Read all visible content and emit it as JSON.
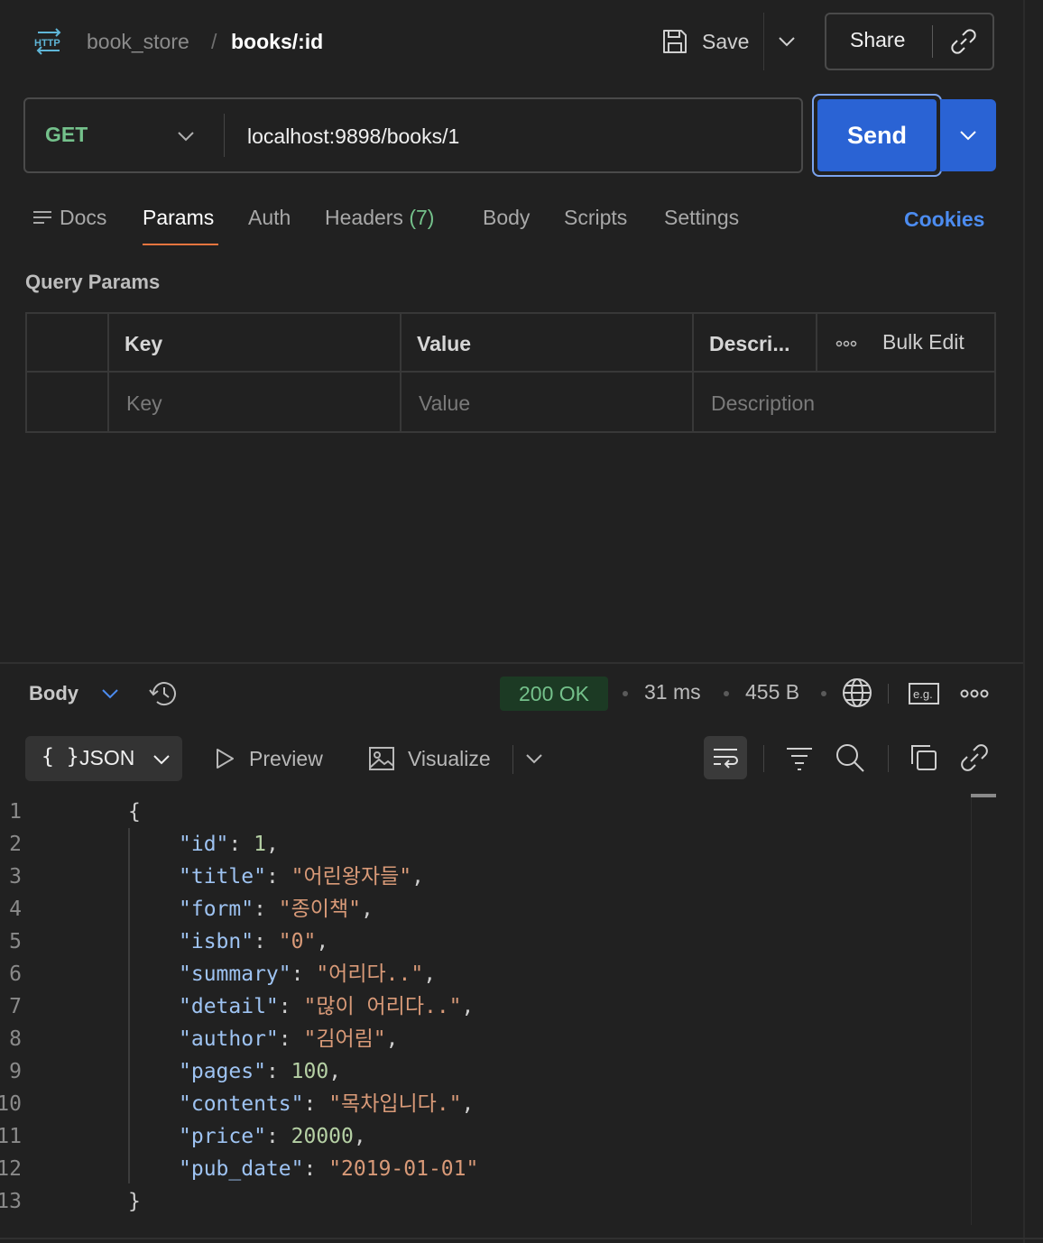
{
  "header": {
    "collection": "book_store",
    "separator": "/",
    "request_name": "books/:id",
    "save_label": "Save",
    "share_label": "Share"
  },
  "request": {
    "method": "GET",
    "url": "localhost:9898/books/1",
    "send_label": "Send"
  },
  "tabs": {
    "docs": "Docs",
    "params": "Params",
    "auth": "Auth",
    "headers": "Headers",
    "headers_count": "(7)",
    "body": "Body",
    "scripts": "Scripts",
    "settings": "Settings",
    "active": "Params",
    "cookies": "Cookies"
  },
  "query_params": {
    "title": "Query Params",
    "columns": [
      "Key",
      "Value",
      "Descri..."
    ],
    "bulk_edit": "Bulk Edit",
    "placeholders": {
      "key": "Key",
      "value": "Value",
      "description": "Description"
    }
  },
  "response": {
    "body_label": "Body",
    "status": "200 OK",
    "time": "31 ms",
    "size": "455 B",
    "format": "JSON",
    "format_braces": "{ }",
    "preview": "Preview",
    "visualize": "Visualize",
    "lines": [
      {
        "n": "1",
        "text": "{"
      },
      {
        "n": "2",
        "key": "\"id\"",
        "value": "1",
        "type": "num",
        "comma": ","
      },
      {
        "n": "3",
        "key": "\"title\"",
        "value": "\"어린왕자들\"",
        "type": "str",
        "comma": ","
      },
      {
        "n": "4",
        "key": "\"form\"",
        "value": "\"종이책\"",
        "type": "str",
        "comma": ","
      },
      {
        "n": "5",
        "key": "\"isbn\"",
        "value": "\"0\"",
        "type": "str",
        "comma": ","
      },
      {
        "n": "6",
        "key": "\"summary\"",
        "value": "\"어리다..\"",
        "type": "str",
        "comma": ","
      },
      {
        "n": "7",
        "key": "\"detail\"",
        "value": "\"많이 어리다..\"",
        "type": "str",
        "comma": ","
      },
      {
        "n": "8",
        "key": "\"author\"",
        "value": "\"김어림\"",
        "type": "str",
        "comma": ","
      },
      {
        "n": "9",
        "key": "\"pages\"",
        "value": "100",
        "type": "num",
        "comma": ","
      },
      {
        "n": "10",
        "key": "\"contents\"",
        "value": "\"목차입니다.\"",
        "type": "str",
        "comma": ","
      },
      {
        "n": "11",
        "key": "\"price\"",
        "value": "20000",
        "type": "num",
        "comma": ","
      },
      {
        "n": "12",
        "key": "\"pub_date\"",
        "value": "\"2019-01-01\"",
        "type": "str",
        "comma": ""
      },
      {
        "n": "13",
        "text": "}"
      }
    ]
  },
  "colors": {
    "accent_blue": "#2a63d4",
    "method_green": "#74c18b",
    "tab_underline": "#e8753f",
    "cookies_blue": "#4c8cf0"
  },
  "icons": {
    "http": "http-icon",
    "save": "save-icon",
    "link": "link-icon",
    "history": "history-icon",
    "globe": "globe-icon",
    "example": "example-icon",
    "more": "more-icon",
    "wrap": "wrap-icon",
    "filter": "filter-icon",
    "search": "search-icon",
    "copy": "copy-icon"
  }
}
